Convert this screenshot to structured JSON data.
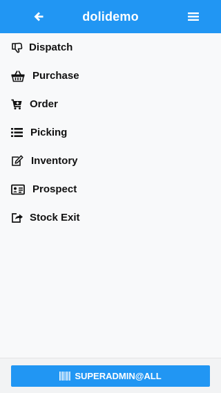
{
  "header": {
    "title": "dolidemo",
    "back_icon": "arrow-left-icon",
    "menu_icon": "hamburger-menu-icon",
    "color": "#2196f3"
  },
  "menu": {
    "items": [
      {
        "label": "Dispatch",
        "icon": "thumbs-down-icon"
      },
      {
        "label": "Purchase",
        "icon": "shopping-basket-icon"
      },
      {
        "label": "Order",
        "icon": "cart-plus-icon"
      },
      {
        "label": "Picking",
        "icon": "list-icon"
      },
      {
        "label": "Inventory",
        "icon": "edit-icon"
      },
      {
        "label": "Prospect",
        "icon": "id-card-icon"
      },
      {
        "label": "Stock Exit",
        "icon": "share-square-icon"
      }
    ]
  },
  "footer": {
    "user_label": "SUPERADMIN@ALL",
    "user_icon": "barcode-icon"
  }
}
